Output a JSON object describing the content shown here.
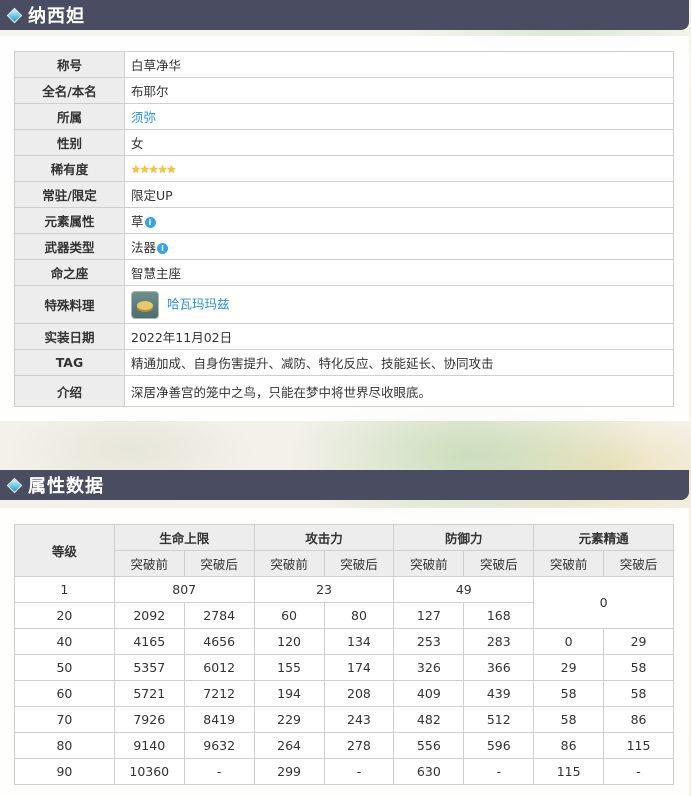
{
  "section1": {
    "title": "纳西妲"
  },
  "section2": {
    "title": "属性数据"
  },
  "info": {
    "rows": [
      {
        "label": "称号",
        "value": "白草净华"
      },
      {
        "label": "全名/本名",
        "value": "布耶尔"
      },
      {
        "label": "所属",
        "value": "须弥"
      },
      {
        "label": "性别",
        "value": "女"
      },
      {
        "label": "稀有度",
        "value": "★★★★★"
      },
      {
        "label": "常驻/限定",
        "value": "限定UP"
      },
      {
        "label": "元素属性",
        "value": "草"
      },
      {
        "label": "武器类型",
        "value": "法器"
      },
      {
        "label": "命之座",
        "value": "智慧主座"
      },
      {
        "label": "特殊料理",
        "value": "哈瓦玛玛兹"
      },
      {
        "label": "实装日期",
        "value": "2022年11月02日"
      },
      {
        "label": "TAG",
        "value": "精通加成、自身伤害提升、减防、特化反应、技能延长、协同攻击"
      },
      {
        "label": "介绍",
        "value": "深居净善宫的笼中之鸟，只能在梦中将世界尽收眼底。"
      }
    ]
  },
  "stats": {
    "level_header": "等级",
    "groups": [
      "生命上限",
      "攻击力",
      "防御力",
      "元素精通"
    ],
    "before": "突破前",
    "after": "突破后",
    "row1": {
      "level": "1",
      "hp": "807",
      "atk": "23",
      "def": "49",
      "em": "0"
    },
    "rows": [
      {
        "level": "20",
        "hp_b": "2092",
        "hp_a": "2784",
        "atk_b": "60",
        "atk_a": "80",
        "def_b": "127",
        "def_a": "168"
      },
      {
        "level": "40",
        "hp_b": "4165",
        "hp_a": "4656",
        "atk_b": "120",
        "atk_a": "134",
        "def_b": "253",
        "def_a": "283",
        "em_b": "0",
        "em_a": "29"
      },
      {
        "level": "50",
        "hp_b": "5357",
        "hp_a": "6012",
        "atk_b": "155",
        "atk_a": "174",
        "def_b": "326",
        "def_a": "366",
        "em_b": "29",
        "em_a": "58"
      },
      {
        "level": "60",
        "hp_b": "5721",
        "hp_a": "7212",
        "atk_b": "194",
        "atk_a": "208",
        "def_b": "409",
        "def_a": "439",
        "em_b": "58",
        "em_a": "58"
      },
      {
        "level": "70",
        "hp_b": "7926",
        "hp_a": "8419",
        "atk_b": "229",
        "atk_a": "243",
        "def_b": "482",
        "def_a": "512",
        "em_b": "58",
        "em_a": "86"
      },
      {
        "level": "80",
        "hp_b": "9140",
        "hp_a": "9632",
        "atk_b": "264",
        "atk_a": "278",
        "def_b": "556",
        "def_a": "596",
        "em_b": "86",
        "em_a": "115"
      },
      {
        "level": "90",
        "hp_b": "10360",
        "hp_a": "-",
        "atk_b": "299",
        "atk_a": "-",
        "def_b": "630",
        "def_a": "-",
        "em_b": "115",
        "em_a": "-"
      }
    ]
  },
  "colors": {
    "header_bg": "#4a4d61",
    "link": "#2b8fd6",
    "label_bg": "#ededed"
  }
}
